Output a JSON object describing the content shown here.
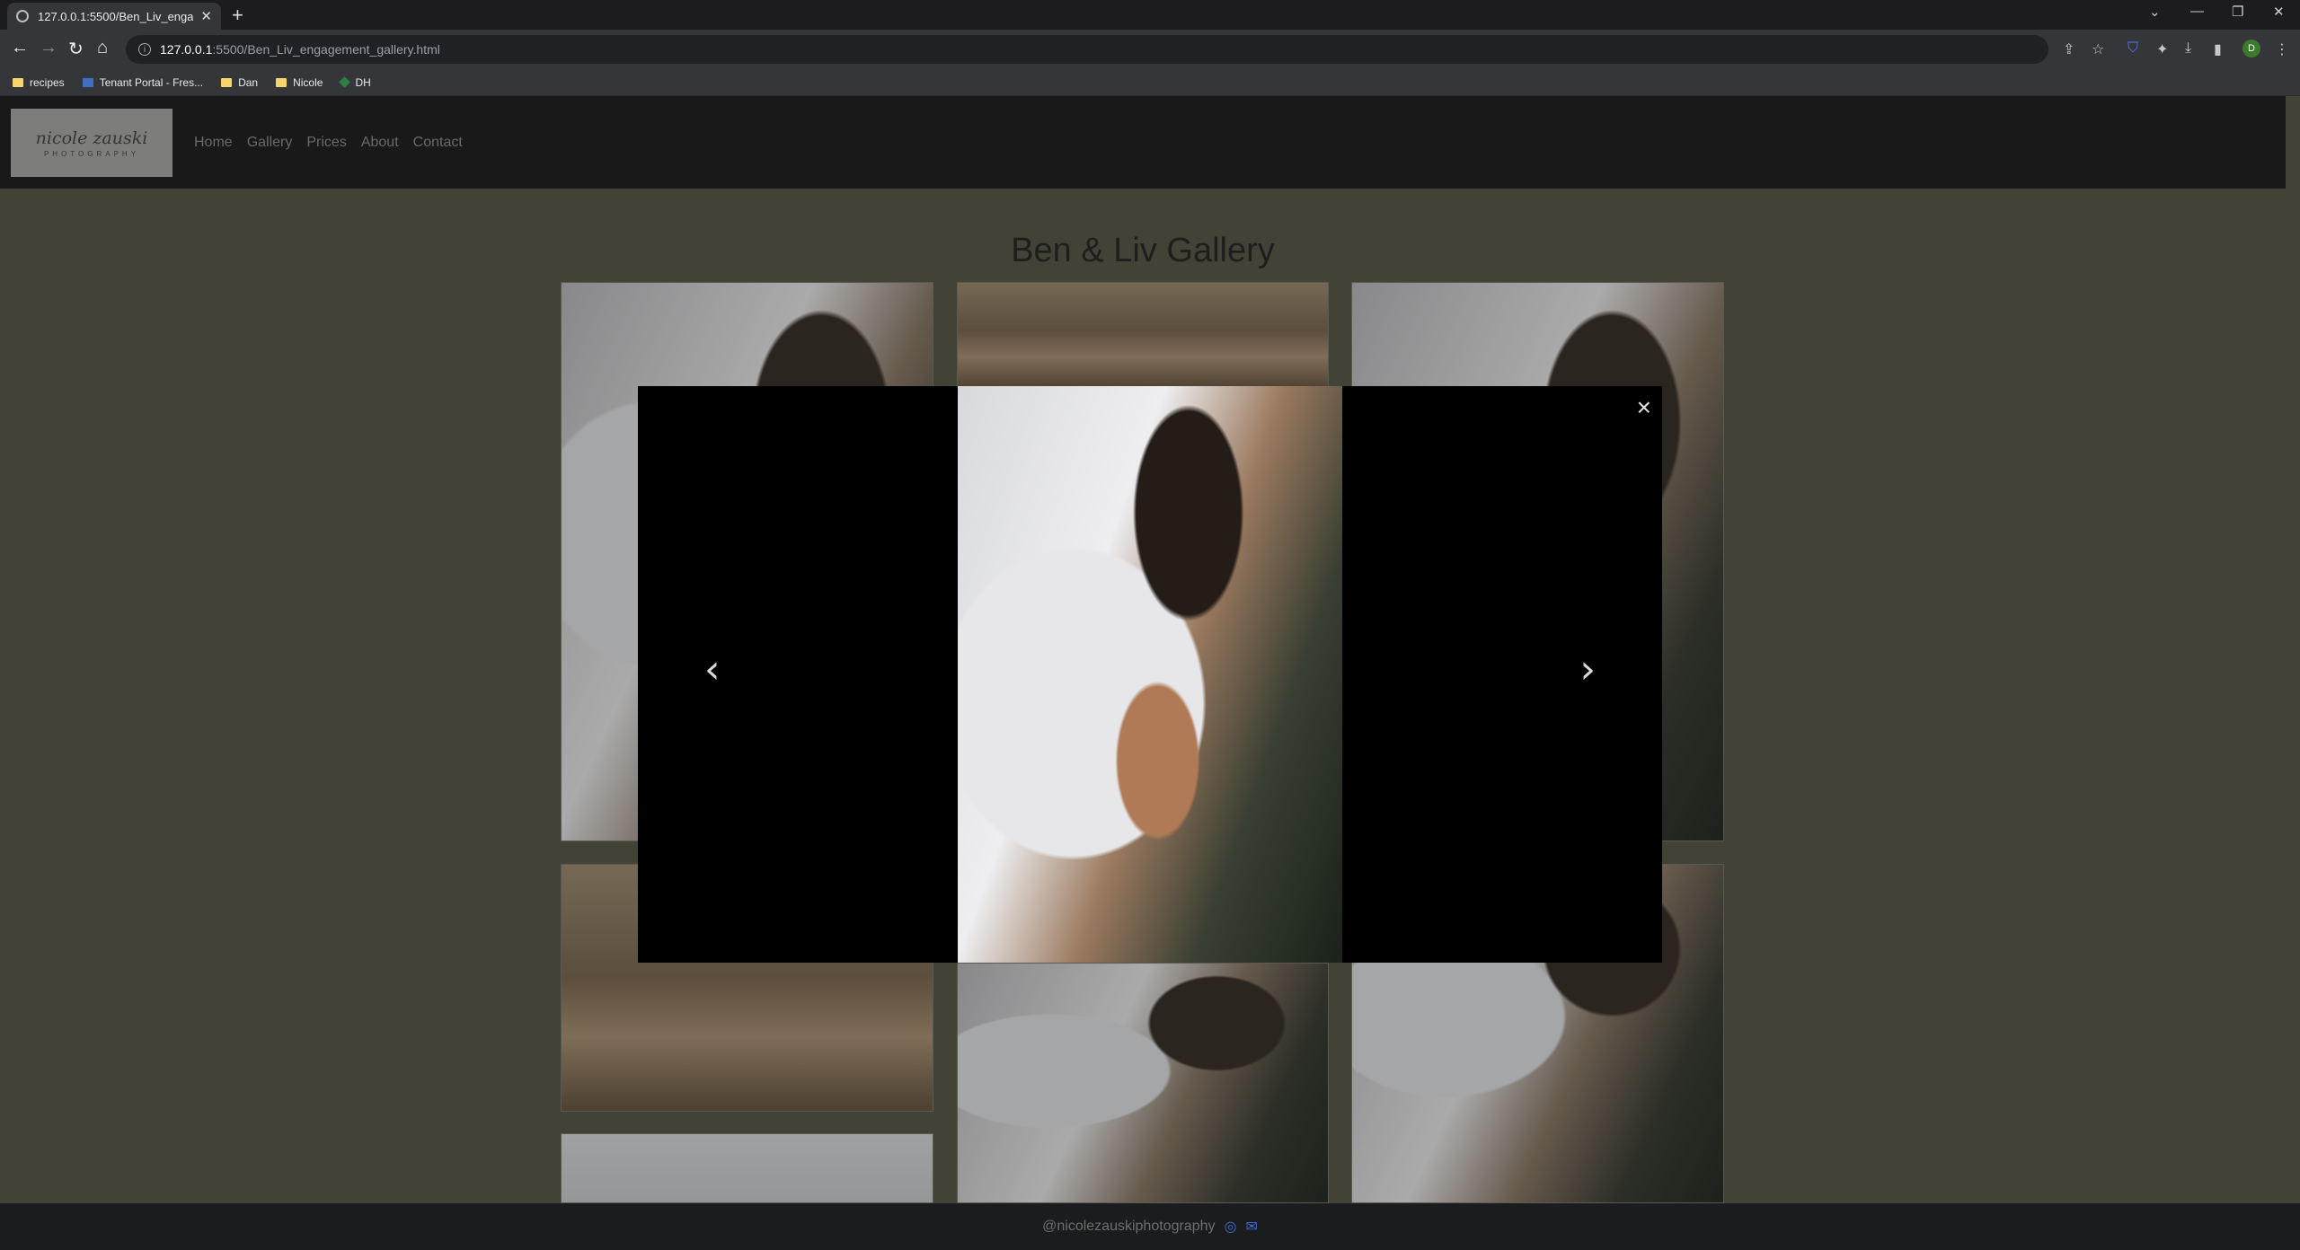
{
  "browser": {
    "tab_title": "127.0.0.1:5500/Ben_Liv_engagem",
    "url_host": "127.0.0.1",
    "url_path": ":5500/Ben_Liv_engagement_gallery.html",
    "bookmarks": [
      {
        "label": "recipes",
        "icon": "folder-icon"
      },
      {
        "label": "Tenant Portal - Fres...",
        "icon": "portal-icon"
      },
      {
        "label": "Dan",
        "icon": "folder-icon"
      },
      {
        "label": "Nicole",
        "icon": "folder-icon"
      },
      {
        "label": "DH",
        "icon": "dh-icon"
      }
    ],
    "profile_initial": "D"
  },
  "site": {
    "logo_text": "nicole zauski",
    "logo_sub": "PHOTOGRAPHY",
    "nav": [
      "Home",
      "Gallery",
      "Prices",
      "About",
      "Contact"
    ],
    "page_title": "Ben & Liv Gallery",
    "footer_handle": "@nicolezauskiphotography"
  },
  "lightbox": {
    "close_symbol": "×",
    "prev_symbol": "‹",
    "next_symbol": "›"
  },
  "colors": {
    "page_bg": "#4b4c3c",
    "header_bg": "#141516",
    "footer_bg": "#1b1c1d",
    "nav_text": "#7f7f7f",
    "footer_icon": "#3f6bd9"
  }
}
